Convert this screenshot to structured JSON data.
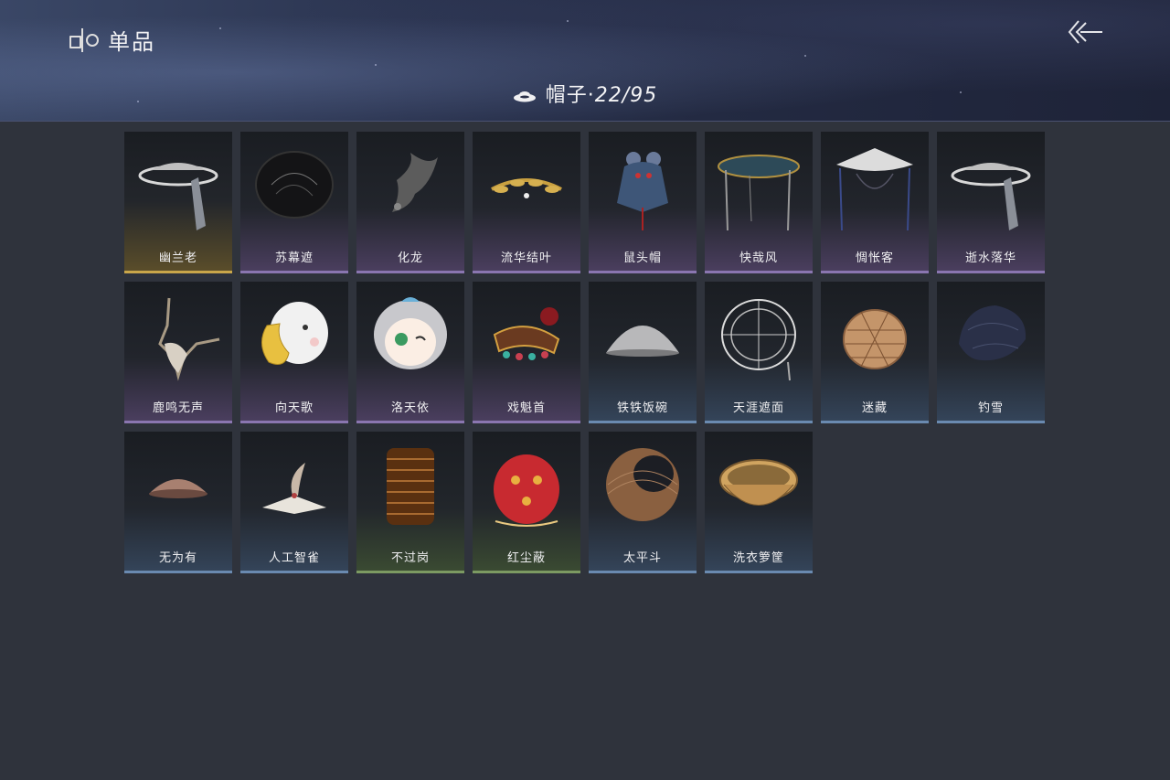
{
  "header": {
    "title": "单品",
    "category_label": "帽子·",
    "count": "22/95"
  },
  "items": [
    {
      "name": "幽兰老",
      "quality": "gold"
    },
    {
      "name": "苏幕遮",
      "quality": "purple"
    },
    {
      "name": "化龙",
      "quality": "purple"
    },
    {
      "name": "流华结叶",
      "quality": "purple"
    },
    {
      "name": "鼠头帽",
      "quality": "purple"
    },
    {
      "name": "快哉风",
      "quality": "purple"
    },
    {
      "name": "惆怅客",
      "quality": "purple"
    },
    {
      "name": "逝水落华",
      "quality": "purple"
    },
    {
      "name": "鹿鸣无声",
      "quality": "purple"
    },
    {
      "name": "向天歌",
      "quality": "purple"
    },
    {
      "name": "洛天依",
      "quality": "purple"
    },
    {
      "name": "戏魁首",
      "quality": "purple"
    },
    {
      "name": "铁铁饭碗",
      "quality": "blue"
    },
    {
      "name": "天涯遮面",
      "quality": "blue"
    },
    {
      "name": "迷藏",
      "quality": "blue"
    },
    {
      "name": "钓雪",
      "quality": "blue"
    },
    {
      "name": "无为有",
      "quality": "blue"
    },
    {
      "name": "人工智雀",
      "quality": "blue"
    },
    {
      "name": "不过岗",
      "quality": "green"
    },
    {
      "name": "红尘蔽",
      "quality": "green"
    },
    {
      "name": "太平斗",
      "quality": "blue"
    },
    {
      "name": "洗衣箩筐",
      "quality": "blue"
    }
  ]
}
